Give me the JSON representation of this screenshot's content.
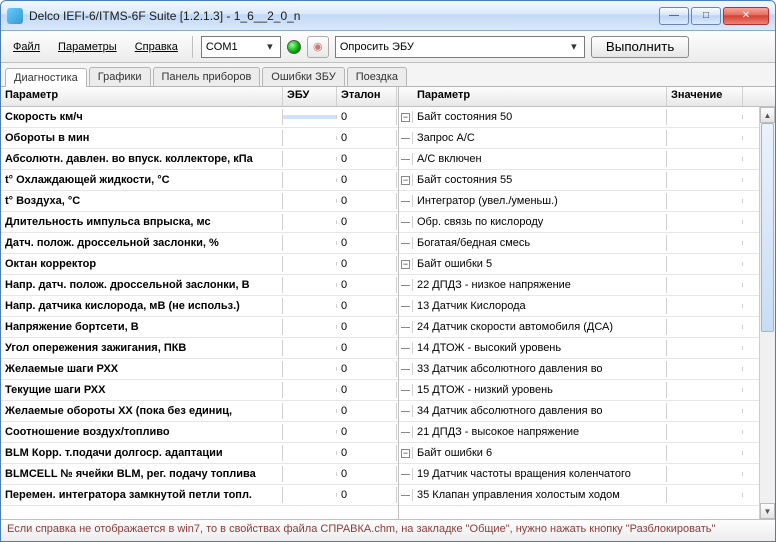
{
  "window": {
    "title": "Delco IEFI-6/ITMS-6F Suite [1.2.1.3] - 1_6__2_0_n"
  },
  "menu": {
    "file": "Файл",
    "params": "Параметры",
    "help": "Справка",
    "port": "COM1",
    "action": "Опросить ЭБУ",
    "run": "Выполнить"
  },
  "tabs": [
    "Диагностика",
    "Графики",
    "Панель приборов",
    "Ошибки ЗБУ",
    "Поездка"
  ],
  "left": {
    "headers": {
      "param": "Параметр",
      "ecu": "ЭБУ",
      "etalon": "Эталон"
    },
    "rows": [
      {
        "param": "Скорость км/ч",
        "ecu": "",
        "etalon": "0",
        "sel": true
      },
      {
        "param": "Обороты в мин",
        "ecu": "",
        "etalon": "0"
      },
      {
        "param": "Абсолютн. давлен. во впуск. коллекторе, кПа",
        "ecu": "",
        "etalon": "0"
      },
      {
        "param": "t° Охлаждающей жидкости, °С",
        "ecu": "",
        "etalon": "0"
      },
      {
        "param": "t° Воздуха, °С",
        "ecu": "",
        "etalon": "0"
      },
      {
        "param": "Длительность импульса впрыска, мс",
        "ecu": "",
        "etalon": "0"
      },
      {
        "param": "Датч. полож. дроссельной заслонки, %",
        "ecu": "",
        "etalon": "0"
      },
      {
        "param": "Октан корректор",
        "ecu": "",
        "etalon": "0"
      },
      {
        "param": "Напр. датч. полож. дроссельной заслонки, В",
        "ecu": "",
        "etalon": "0"
      },
      {
        "param": "Напр. датчика кислорода, мВ (не использ.)",
        "ecu": "",
        "etalon": "0"
      },
      {
        "param": "Напряжение бортсети, В",
        "ecu": "",
        "etalon": "0"
      },
      {
        "param": "Угол опережения зажигания, ПКВ",
        "ecu": "",
        "etalon": "0"
      },
      {
        "param": "Желаемые шаги РХХ",
        "ecu": "",
        "etalon": "0"
      },
      {
        "param": "Текущие шаги РХХ",
        "ecu": "",
        "etalon": "0"
      },
      {
        "param": "Желаемые обороты ХХ (пока без единиц,",
        "ecu": "",
        "etalon": "0"
      },
      {
        "param": "Соотношение воздух/топливо",
        "ecu": "",
        "etalon": "0"
      },
      {
        "param": "BLM Корр. т.подачи долгоср. адаптации",
        "ecu": "",
        "etalon": "0"
      },
      {
        "param": "BLMCELL № ячейки BLM, рег. подачу топлива",
        "ecu": "",
        "etalon": "0"
      },
      {
        "param": "Перемен. интегратора замкнутой петли топл.",
        "ecu": "",
        "etalon": "0"
      }
    ]
  },
  "right": {
    "headers": {
      "param": "Параметр",
      "value": "Значение"
    },
    "rows": [
      {
        "t": "group",
        "param": "Байт состояния 50"
      },
      {
        "t": "item",
        "param": "Запрос A/C"
      },
      {
        "t": "item",
        "param": "A/C включен"
      },
      {
        "t": "group",
        "param": "Байт состояния 55"
      },
      {
        "t": "item",
        "param": "Интегратор (увел./уменьш.)"
      },
      {
        "t": "item",
        "param": "Обр. связь по кислороду"
      },
      {
        "t": "item",
        "param": "Богатая/бедная смесь"
      },
      {
        "t": "group",
        "param": "Байт ошибки 5"
      },
      {
        "t": "item",
        "param": "22 ДПДЗ - низкое напряжение"
      },
      {
        "t": "item",
        "param": "13 Датчик Кислорода"
      },
      {
        "t": "item",
        "param": "24 Датчик скорости автомобиля (ДСА)"
      },
      {
        "t": "item",
        "param": "14 ДТОЖ - высокий уровень"
      },
      {
        "t": "item",
        "param": "33 Датчик абсолютного давления во"
      },
      {
        "t": "item",
        "param": "15 ДТОЖ - низкий уровень"
      },
      {
        "t": "item",
        "param": "34 Датчик абсолютного давления во"
      },
      {
        "t": "item",
        "param": "21 ДПДЗ - высокое напряжение"
      },
      {
        "t": "group",
        "param": "Байт ошибки 6"
      },
      {
        "t": "item",
        "param": "19 Датчик частоты вращения коленчатого"
      },
      {
        "t": "item",
        "param": "35 Клапан управления холостым ходом"
      }
    ]
  },
  "status": "Если справка не отображается в win7, то в свойствах файла СПРАВКА.chm, на закладке \"Общие\", нужно нажать кнопку \"Разблокировать\""
}
